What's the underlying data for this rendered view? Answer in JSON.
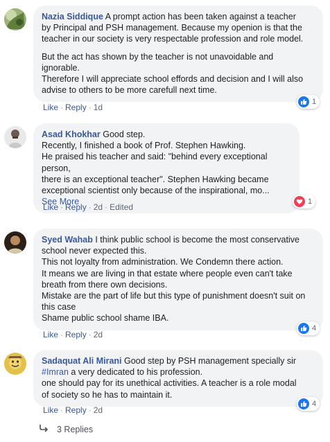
{
  "comments": [
    {
      "author": "Nazia Siddique",
      "paragraphs": [
        [
          " A prompt action has been taken against a teacher",
          "by Principal and PSH management. Because my openion is that the",
          "teacher in our society is very respectable profession and role model."
        ],
        [
          "But the act has shown by the teacher is not unavoidable and",
          "ignorable.",
          "Therefore I will appreciate school effords and decision and I will also",
          "advise to others to be more carefull next time."
        ]
      ],
      "like": "Like",
      "reply": "Reply",
      "time": "1d",
      "reaction": {
        "icon": "thumbs-up-icon",
        "count": "1",
        "color": "#1877f2"
      }
    },
    {
      "author": "Asad Khokhar",
      "lines": [
        " Good step.",
        "Recently, I finished a book of Prof. Stephen Hawking.",
        "He praised his teacher and said: \"behind every exceptional person,",
        "there is an exceptional teacher\". Stephen Hawking became",
        "exceptional scientist only because of the inspirational, mo..."
      ],
      "see_more": "See More",
      "like": "Like",
      "reply": "Reply",
      "time": "2d",
      "edited": "Edited",
      "reaction": {
        "icon": "heart-icon",
        "count": "1",
        "color": "#f33e58"
      }
    },
    {
      "author": "Syed Wahab",
      "lines": [
        " I think public school is become the most conservative",
        "school never expected this.",
        "This not loyalty from administration. We Condemn there action.",
        "It means we are living in that estate where people even can't take",
        "breath from there own decisions.",
        "Mistake are the part of life but this type of punishment doesn't suit on",
        "this case",
        "Shame public school shame IBA."
      ],
      "like": "Like",
      "reply": "Reply",
      "time": "2d",
      "reaction": {
        "icon": "thumbs-up-icon",
        "count": "4",
        "color": "#1877f2"
      }
    },
    {
      "author": "Sadaquat Ali Mirani",
      "lines": [
        " Good step by PSH management specially sir",
        "#Imran",
        " a very dedicated to his profession.",
        "one should pay for its unethical activities. A teacher is a role modal",
        "of society so he has to maintain it."
      ],
      "like": "Like",
      "reply": "Reply",
      "time": "2d",
      "reaction": {
        "icon": "thumbs-up-icon",
        "count": "4",
        "color": "#1877f2"
      }
    }
  ],
  "replies_label": "3 Replies",
  "colors": {
    "link": "#385898",
    "bubble": "#f2f3f5",
    "meta": "#606770"
  }
}
